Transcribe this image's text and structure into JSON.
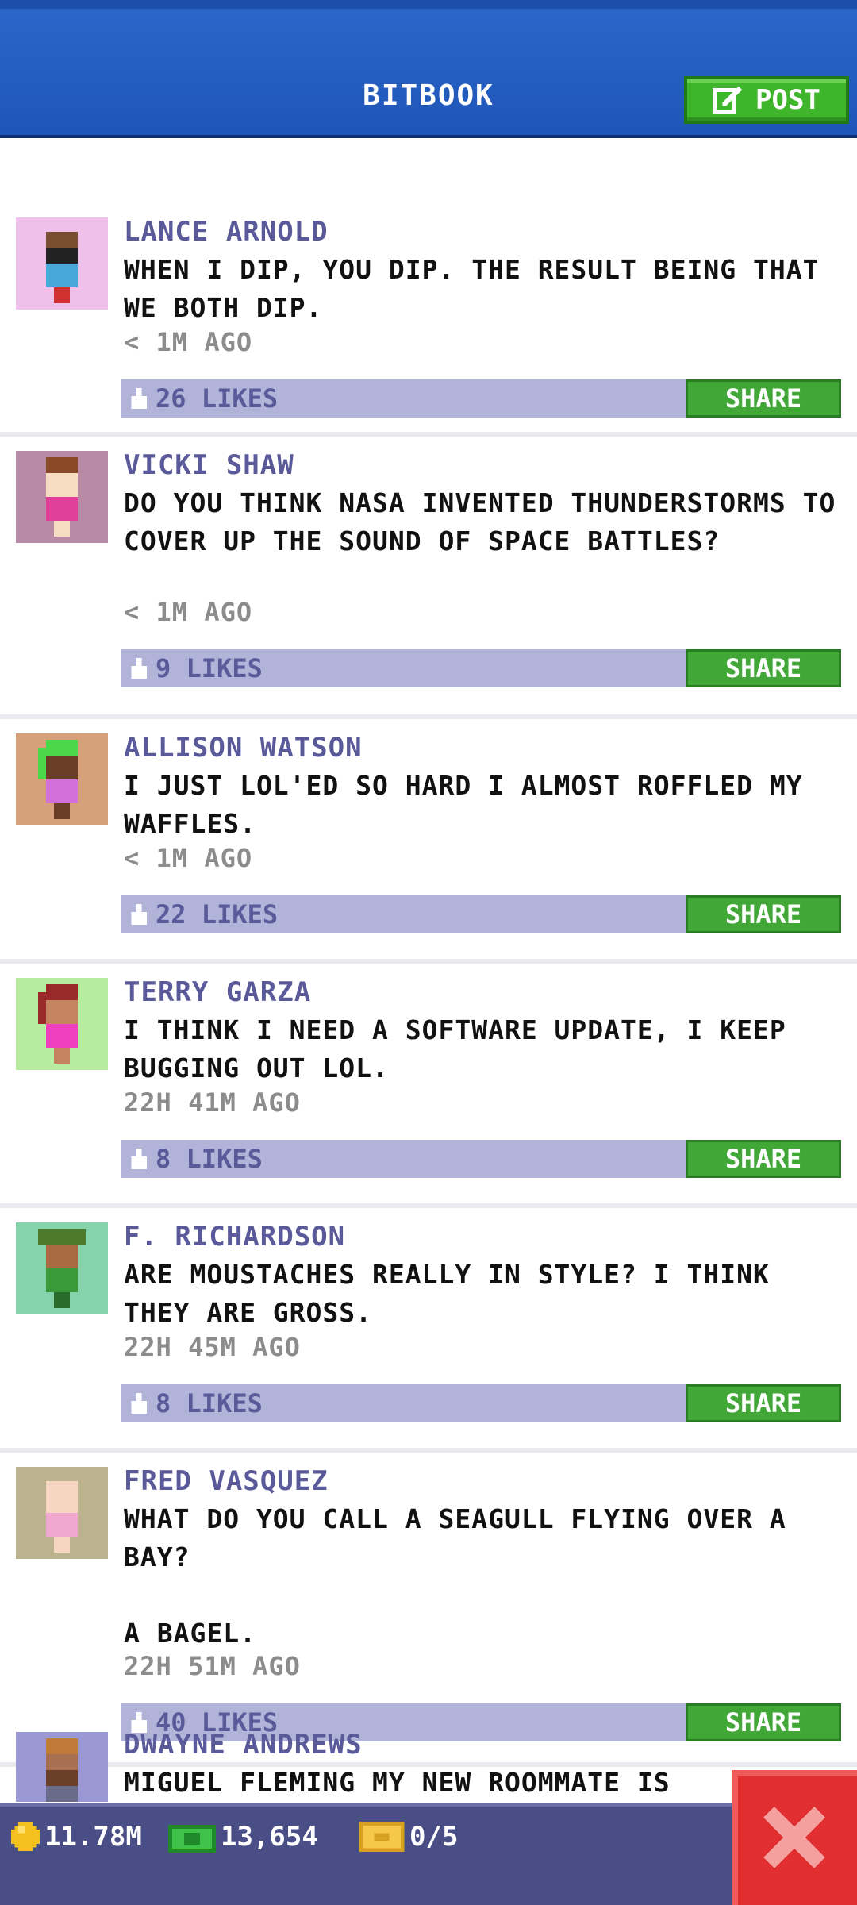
{
  "header": {
    "title": "BITBOOK",
    "post_label": "POST"
  },
  "posts": [
    {
      "name": "LANCE ARNOLD",
      "text": "WHEN I DIP, YOU DIP. THE RESULT BEING THAT WE BOTH DIP.",
      "time": "< 1M AGO",
      "likes": "26 LIKES",
      "share": "SHARE"
    },
    {
      "name": "VICKI SHAW",
      "text": "DO YOU THINK NASA INVENTED THUNDERSTORMS TO COVER UP THE SOUND OF SPACE BATTLES?",
      "time": "< 1M AGO",
      "likes": "9 LIKES",
      "share": "SHARE"
    },
    {
      "name": "ALLISON WATSON",
      "text": "I JUST LOL'ED SO HARD I ALMOST ROFFLED MY WAFFLES.",
      "time": "< 1M AGO",
      "likes": "22 LIKES",
      "share": "SHARE"
    },
    {
      "name": "TERRY GARZA",
      "text": "I THINK I NEED A SOFTWARE UPDATE, I KEEP BUGGING OUT LOL.",
      "time": "22H 41M AGO",
      "likes": "8 LIKES",
      "share": "SHARE"
    },
    {
      "name": "F. RICHARDSON",
      "text": "ARE MOUSTACHES REALLY IN STYLE? I THINK THEY ARE GROSS.",
      "time": "22H 45M AGO",
      "likes": "8 LIKES",
      "share": "SHARE"
    },
    {
      "name": "FRED VASQUEZ",
      "text": "WHAT DO YOU CALL A SEAGULL FLYING OVER A BAY?\n\nA BAGEL.",
      "time": "22H 51M AGO",
      "likes": "40 LIKES",
      "share": "SHARE"
    },
    {
      "name": "DWAYNE ANDREWS",
      "text": "MIGUEL FLEMING MY NEW ROOMMATE IS"
    }
  ],
  "status": {
    "coins": "11.78M",
    "bux": "13,654",
    "tickets": "0/5"
  },
  "colors": {
    "header": "#1e56b8",
    "post_button": "#3fb52b",
    "share_button": "#41a838",
    "like_bar": "#b1b3d8",
    "bottom_bar": "#4a4e86",
    "close_button": "#e12e2e"
  }
}
